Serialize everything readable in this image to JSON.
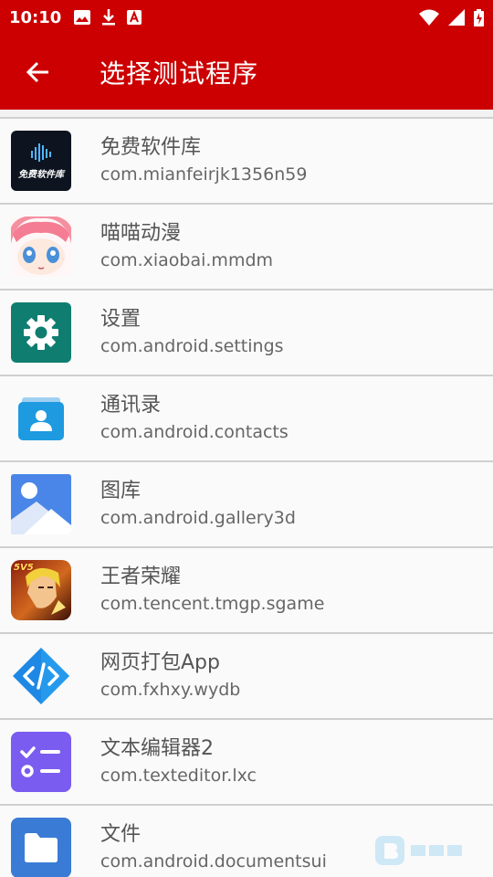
{
  "status": {
    "time": "10:10"
  },
  "appbar": {
    "title": "选择测试程序"
  },
  "apps": [
    {
      "name": "免费软件库",
      "package": "com.mianfeirjk1356n59",
      "icon": "mianfei-app-icon",
      "icon_text": "免费软件库"
    },
    {
      "name": "喵喵动漫",
      "package": "com.xiaobai.mmdm",
      "icon": "anime-girl-app-icon"
    },
    {
      "name": "设置",
      "package": "com.android.settings",
      "icon": "settings-gear-icon"
    },
    {
      "name": "通讯录",
      "package": "com.android.contacts",
      "icon": "contacts-icon"
    },
    {
      "name": "图库",
      "package": "com.android.gallery3d",
      "icon": "gallery-icon"
    },
    {
      "name": "王者荣耀",
      "package": "com.tencent.tmgp.sgame",
      "icon": "game-hero-icon",
      "icon_text": "5V5"
    },
    {
      "name": "网页打包App",
      "package": "com.fxhxy.wydb",
      "icon": "code-brackets-icon"
    },
    {
      "name": "文本编辑器2",
      "package": "com.texteditor.lxc",
      "icon": "checklist-icon"
    },
    {
      "name": "文件",
      "package": "com.android.documentsui",
      "icon": "folder-icon"
    }
  ],
  "colors": {
    "primary": "#cc0000",
    "settings_bg": "#0f7e70",
    "gallery_bg": "#4a86e8",
    "editor_bg": "#7b5cf0",
    "files_bg": "#3a7bd5"
  }
}
